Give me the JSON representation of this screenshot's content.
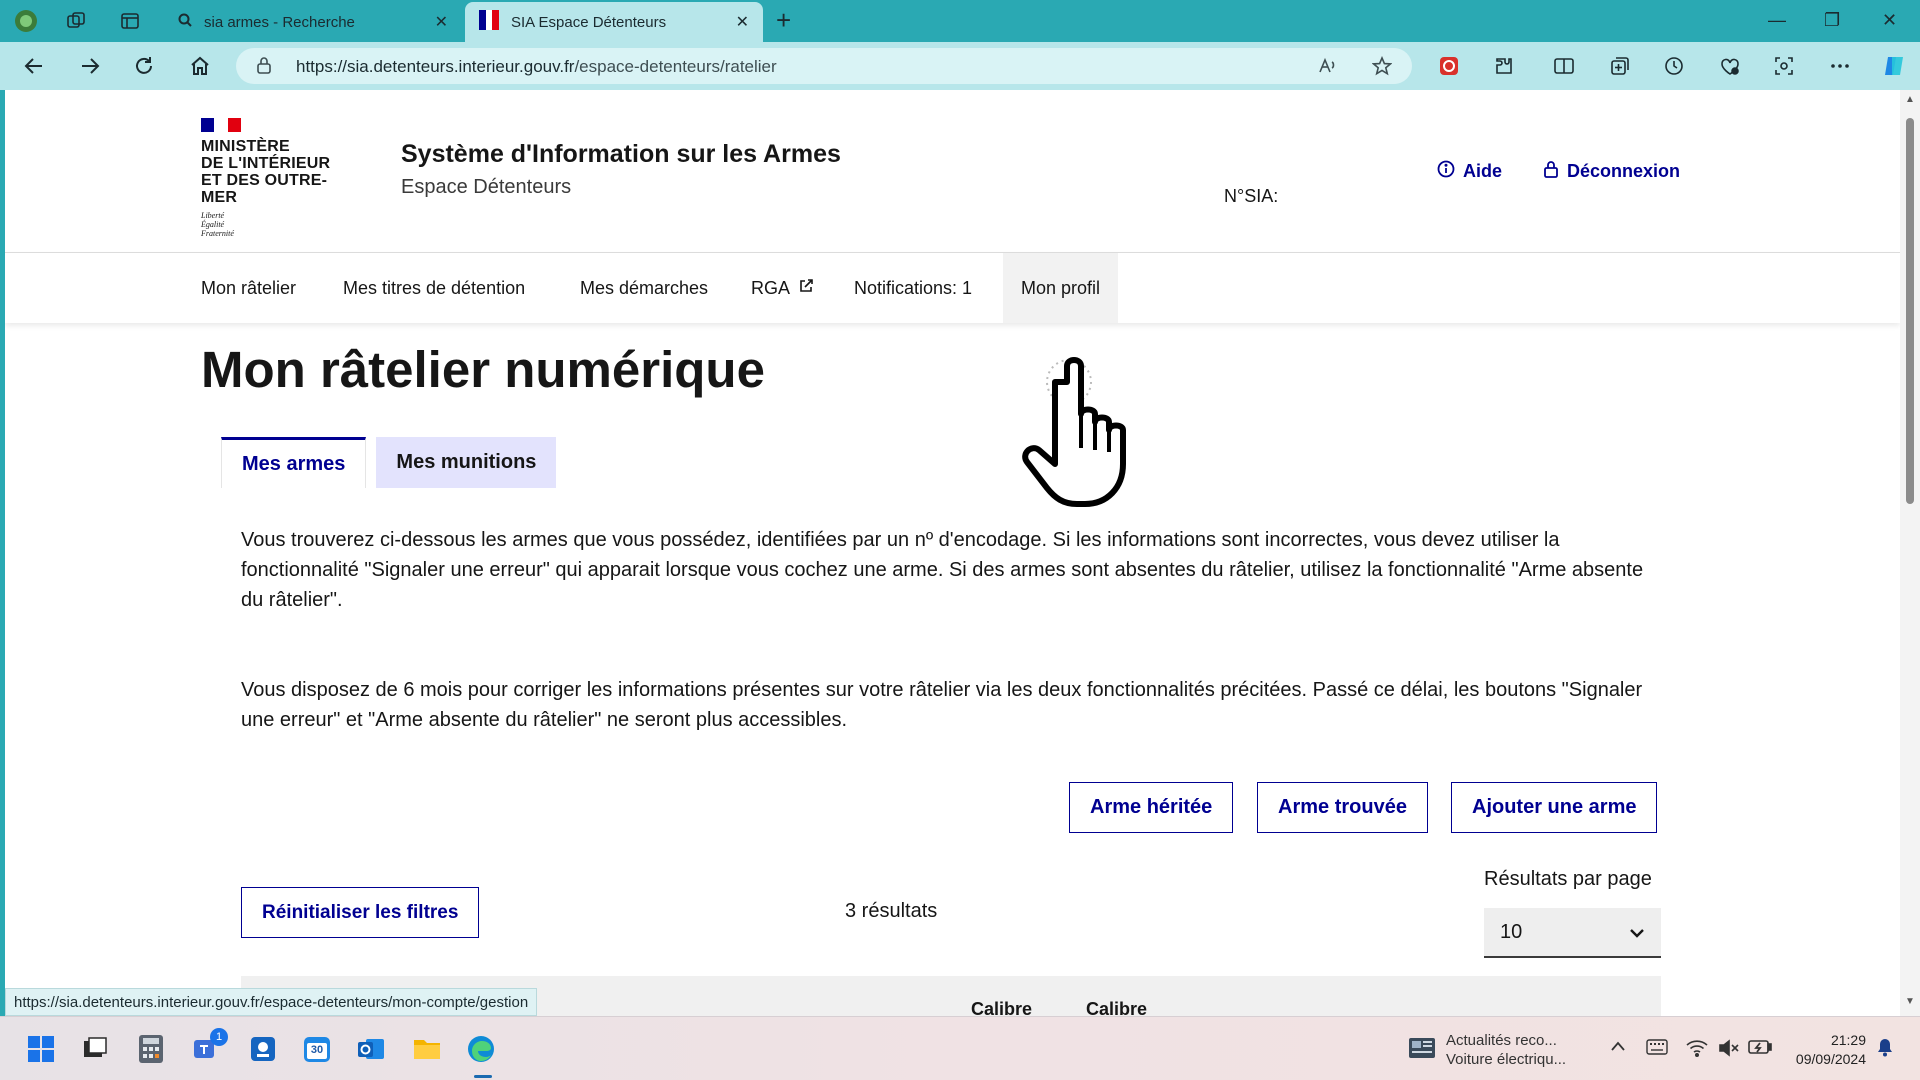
{
  "browser": {
    "tabs": [
      {
        "title": "sia armes - Recherche",
        "active": false
      },
      {
        "title": "SIA Espace Détenteurs",
        "active": true
      }
    ],
    "url_host": "https://sia.detenteurs.interieur.gouv.fr",
    "url_path": "/espace-detenteurs/ratelier",
    "status_url": "https://sia.detenteurs.interieur.gouv.fr/espace-detenteurs/mon-compte/gestion"
  },
  "header": {
    "logo_lines": [
      "MINISTÈRE",
      "DE L'INTÉRIEUR",
      "ET DES OUTRE-MER"
    ],
    "motto": [
      "Liberté",
      "Égalité",
      "Fraternité"
    ],
    "site_title": "Système d'Information sur les Armes",
    "site_subtitle": "Espace Détenteurs",
    "nsia_label": "N°SIA:",
    "help_label": "Aide",
    "logout_label": "Déconnexion"
  },
  "nav": {
    "items": [
      "Mon râtelier",
      "Mes titres de détention",
      "Mes démarches",
      "RGA",
      "Notifications: 1",
      "Mon profil"
    ]
  },
  "main": {
    "title": "Mon râtelier numérique",
    "tabs": [
      "Mes armes",
      "Mes munitions"
    ],
    "paragraph1": "Vous trouverez ci-dessous les armes que vous possédez, identifiées par un nº d'encodage. Si les informations sont incorrectes, vous devez utiliser la fonctionnalité \"Signaler une erreur\" qui apparait lorsque vous cochez une arme. Si des armes sont absentes du râtelier, utilisez la fonctionnalité \"Arme absente du râtelier\".",
    "paragraph2": "Vous disposez de 6 mois pour corriger les informations présentes sur votre râtelier via les deux fonctionnalités précitées. Passé ce délai, les boutons \"Signaler une erreur\" et \"Arme absente du râtelier\" ne seront plus accessibles.",
    "buttons": [
      "Arme héritée",
      "Arme trouvée",
      "Ajouter une arme"
    ],
    "reset_label": "Réinitialiser les filtres",
    "results_count": "3 résultats",
    "per_page_label": "Résultats par page",
    "per_page_value": "10",
    "table_headers": [
      "Calibre",
      "Calibre"
    ]
  },
  "taskbar": {
    "badge_count": "1",
    "calendar_day": "30",
    "news_title": "Actualités reco...",
    "news_sub": "Voiture électriqu...",
    "time": "21:29",
    "date": "09/09/2024"
  },
  "colors": {
    "accent": "#000091",
    "tab_secondary_bg": "#e3e3fd",
    "browser_frame": "#2aa9b3"
  }
}
